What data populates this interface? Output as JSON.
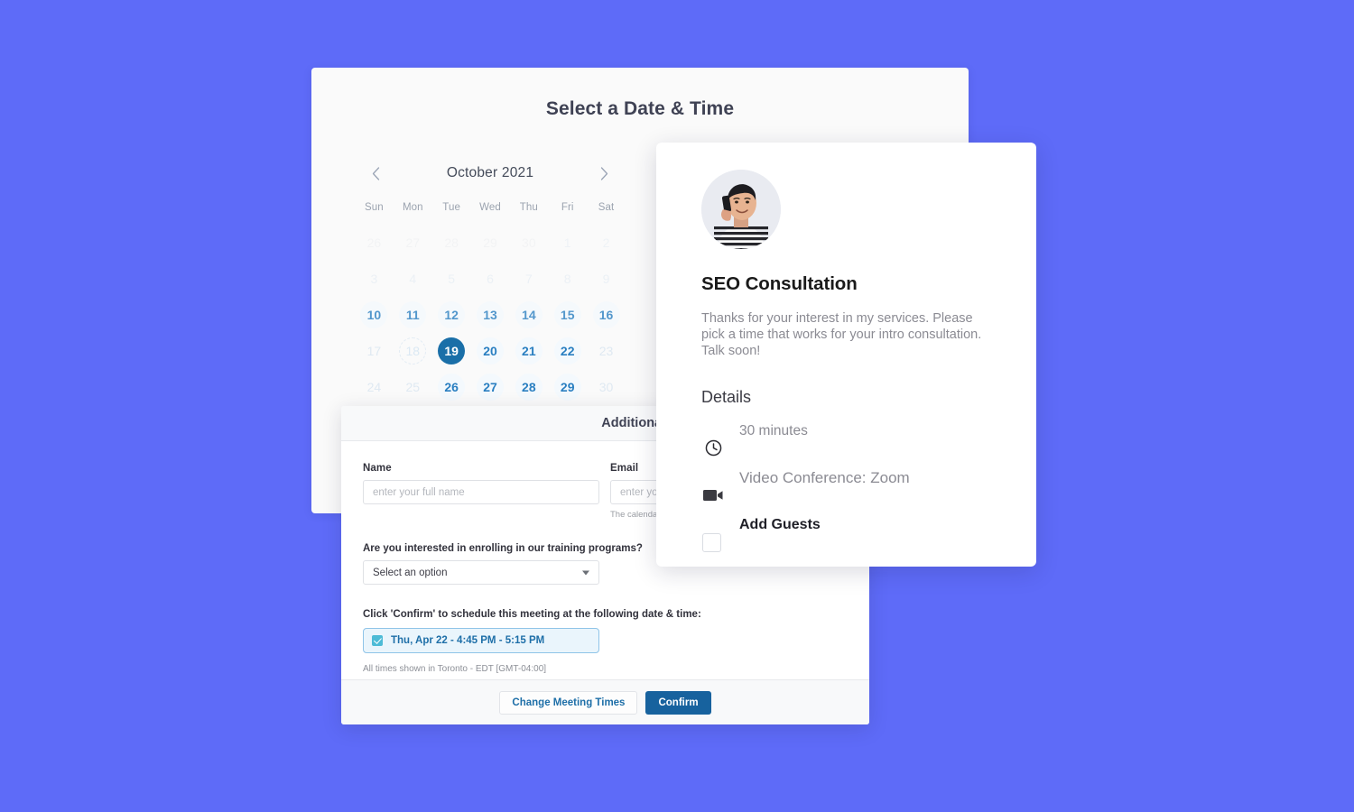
{
  "theme": {
    "background": "#5e6bf8",
    "accent_blue": "#1a6fa8",
    "available_day": "#2a7fc1",
    "primary_button": "#17629e"
  },
  "scheduler": {
    "title": "Select a Date & Time",
    "calendar": {
      "month_label": "October 2021",
      "prev_label": "‹",
      "next_label": "›",
      "weekdays": [
        "Sun",
        "Mon",
        "Tue",
        "Wed",
        "Thu",
        "Fri",
        "Sat"
      ],
      "weeks": [
        [
          {
            "n": "26",
            "state": "muted"
          },
          {
            "n": "27",
            "state": "muted"
          },
          {
            "n": "28",
            "state": "muted"
          },
          {
            "n": "29",
            "state": "muted"
          },
          {
            "n": "30",
            "state": "muted"
          },
          {
            "n": "1",
            "state": "dim"
          },
          {
            "n": "2",
            "state": "dim"
          }
        ],
        [
          {
            "n": "3",
            "state": "dim"
          },
          {
            "n": "4",
            "state": "dim"
          },
          {
            "n": "5",
            "state": "dim"
          },
          {
            "n": "6",
            "state": "dim"
          },
          {
            "n": "7",
            "state": "dim"
          },
          {
            "n": "8",
            "state": "dim"
          },
          {
            "n": "9",
            "state": "dim"
          }
        ],
        [
          {
            "n": "10",
            "state": "avail"
          },
          {
            "n": "11",
            "state": "avail"
          },
          {
            "n": "12",
            "state": "avail"
          },
          {
            "n": "13",
            "state": "avail"
          },
          {
            "n": "14",
            "state": "avail"
          },
          {
            "n": "15",
            "state": "avail"
          },
          {
            "n": "16",
            "state": "avail"
          }
        ],
        [
          {
            "n": "17",
            "state": "dim"
          },
          {
            "n": "18",
            "state": "today"
          },
          {
            "n": "19",
            "state": "sel"
          },
          {
            "n": "20",
            "state": "avail"
          },
          {
            "n": "21",
            "state": "avail"
          },
          {
            "n": "22",
            "state": "avail"
          },
          {
            "n": "23",
            "state": "dim"
          }
        ],
        [
          {
            "n": "24",
            "state": "dim"
          },
          {
            "n": "25",
            "state": "dim"
          },
          {
            "n": "26",
            "state": "avail"
          },
          {
            "n": "27",
            "state": "avail"
          },
          {
            "n": "28",
            "state": "avail"
          },
          {
            "n": "29",
            "state": "avail"
          },
          {
            "n": "30",
            "state": "dim"
          }
        ]
      ]
    }
  },
  "event_card": {
    "avatar_icon": "person-on-phone-photo",
    "title": "SEO Consultation",
    "description": "Thanks for your interest in my services. Please pick a time that works for your intro consultation. Talk soon!",
    "details_heading": "Details",
    "details": [
      {
        "icon": "clock-icon",
        "label": "30 minutes"
      },
      {
        "icon": "video-camera-icon",
        "label": "Video Conference: Zoom"
      },
      {
        "icon": "checkbox-icon",
        "label": "Add Guests"
      }
    ]
  },
  "form": {
    "header_title": "Additional Details",
    "name_label": "Name",
    "name_placeholder": "enter your full name",
    "name_value": "",
    "email_label": "Email",
    "email_placeholder": "enter your email",
    "email_value": "",
    "email_hint": "The calendar invite will be sent to this address",
    "question_label": "Are you interested in enrolling in our training programs?",
    "select_value": "Select an option",
    "confirm_prompt": "Click 'Confirm' to schedule this meeting at the following date & time:",
    "slot_text": "Thu, Apr 22 - 4:45 PM - 5:15 PM",
    "timezone_note": "All times shown in Toronto - EDT [GMT-04:00]",
    "change_button": "Change Meeting Times",
    "confirm_button": "Confirm"
  }
}
